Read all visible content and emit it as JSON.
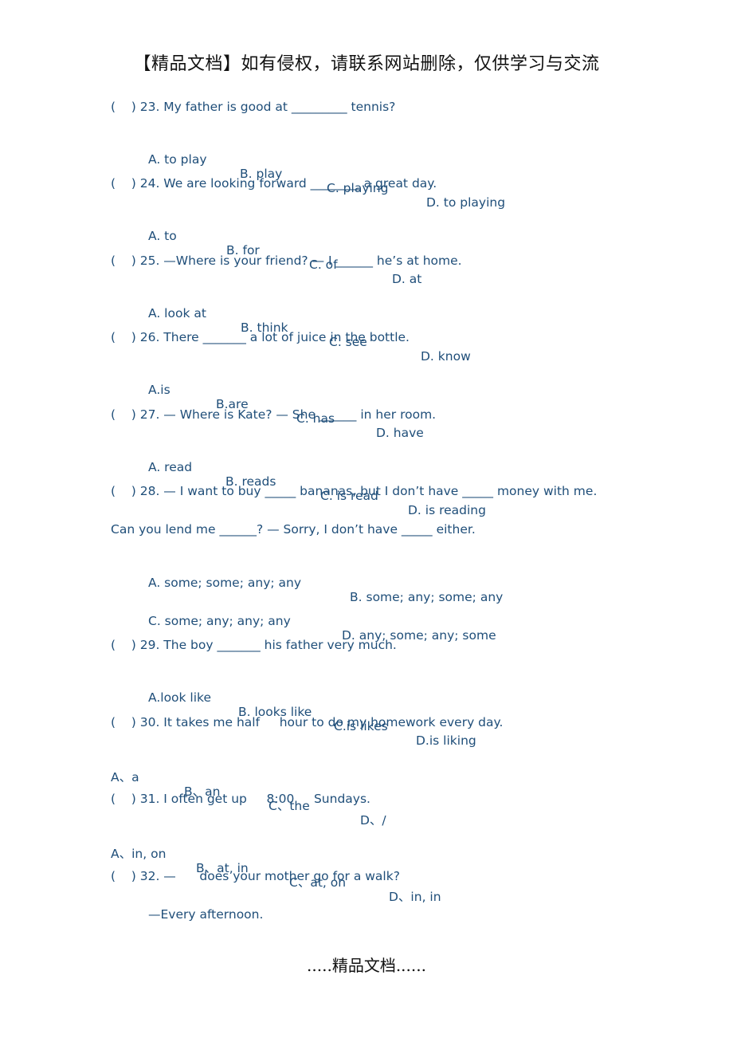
{
  "header": "【精品文档】如有侵权，请联系网站删除，仅供学习与交流",
  "footer": ".....精品文档......",
  "questions": [
    {
      "stem": "(    ) 23. My father is good at _________ tennis?",
      "options": [
        "A. to play",
        "B. play",
        "C. playing",
        "D. to playing"
      ]
    },
    {
      "stem": "(    ) 24. We are looking forward ________ a great day.",
      "options": [
        "A. to",
        "B. for",
        "C. of",
        "D. at"
      ]
    },
    {
      "stem": "(    ) 25. —Where is your friend? — I ______ he’s at home.",
      "options": [
        "A. look at",
        "B. think",
        "C. see",
        "D. know"
      ]
    },
    {
      "stem": "(    ) 26. There _______ a lot of juice in the bottle.",
      "options": [
        "A.is",
        "B.are",
        "C. has",
        "D. have"
      ]
    },
    {
      "stem": "(    ) 27. — Where is Kate? — She ______ in her room.",
      "options": [
        "A. read",
        "B. reads",
        "C. is read",
        "D. is reading"
      ]
    },
    {
      "stem": "(    ) 28. — I want to buy _____ bananas, but I don’t have _____ money with me.",
      "stem_cont": "Can you lend me ______? — Sorry, I don’t have _____ either.",
      "options": [
        "A. some; some; any; any",
        "B. some; any; some; any",
        "C. some; any; any; any",
        "D. any; some; any; some"
      ]
    },
    {
      "stem": "(    ) 29. The boy _______ his father very much.",
      "options": [
        "A.look like",
        "B. looks like",
        "C.is likes",
        "D.is liking"
      ]
    },
    {
      "stem": "(    ) 30. It takes me half     hour to do my homework every day.",
      "options": [
        "A、a",
        "B、an",
        "C、the",
        "D、/"
      ]
    },
    {
      "stem": "(    ) 31. I often get up     8:00     Sundays.",
      "options": [
        "A、in, on",
        "B、at, in",
        "C、at, on",
        "D、in, in"
      ]
    },
    {
      "stem": "(    ) 32. —      does your mother go for a walk?",
      "answer_line": "—Every afternoon."
    }
  ]
}
